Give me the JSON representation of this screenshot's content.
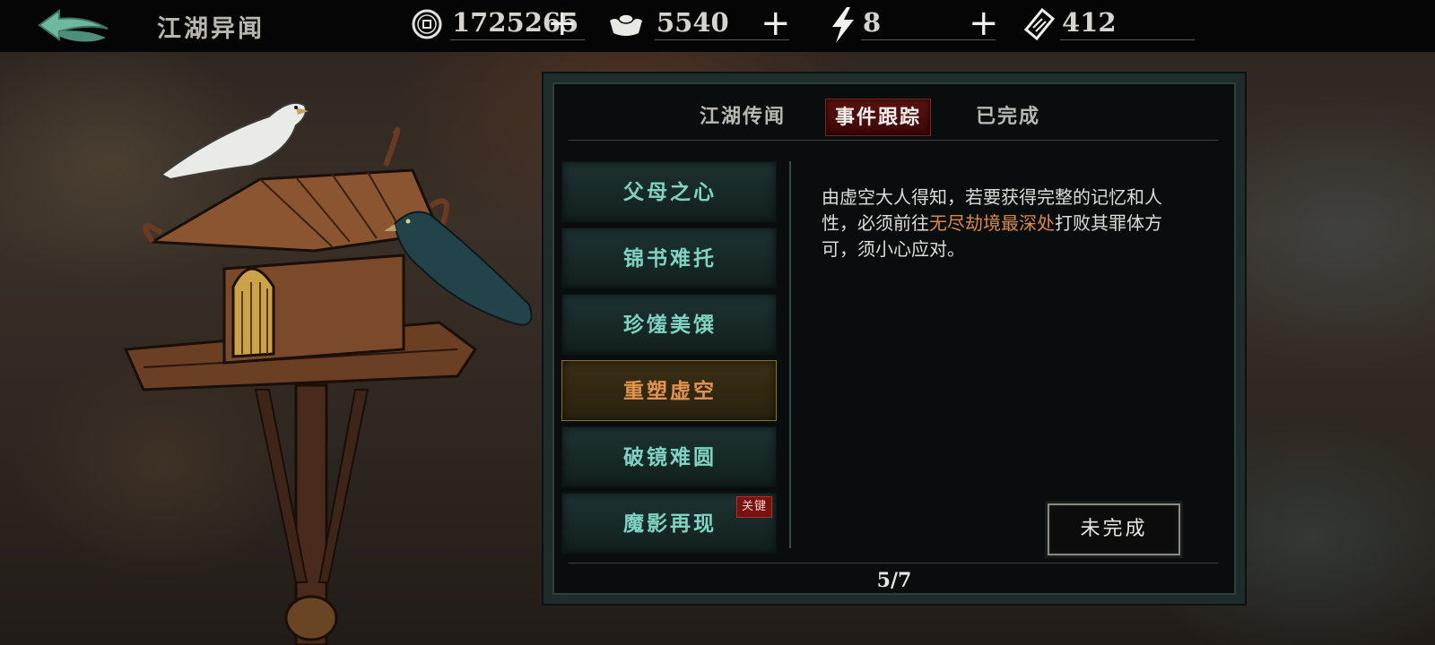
{
  "header": {
    "title": "江湖异闻",
    "back_icon": "back-arrow-icon",
    "resources": [
      {
        "id": "coins",
        "icon": "copper-coin-icon",
        "value": "1725265"
      },
      {
        "id": "ingots",
        "icon": "silver-ingot-icon",
        "value": "5540"
      },
      {
        "id": "energy",
        "icon": "lightning-icon",
        "value": "8"
      },
      {
        "id": "tickets",
        "icon": "ticket-icon",
        "value": "412"
      }
    ],
    "plus_label": "+"
  },
  "tabs": [
    {
      "label": "江湖传闻",
      "active": false
    },
    {
      "label": "事件跟踪",
      "active": true
    },
    {
      "label": "已完成",
      "active": false
    }
  ],
  "events": [
    {
      "label": "父母之心",
      "selected": false
    },
    {
      "label": "锦书难托",
      "selected": false
    },
    {
      "label": "珍馐美馔",
      "selected": false
    },
    {
      "label": "重塑虚空",
      "selected": true
    },
    {
      "label": "破镜难圆",
      "selected": false
    },
    {
      "label": "魔影再现",
      "selected": false,
      "badge": "关键"
    }
  ],
  "detail": {
    "text_before": "由虚空大人得知，若要获得完整的记忆和人性，必须前往",
    "highlight": "无尽劫境最深处",
    "text_after": "打败其罪体方可，须小心应对。",
    "status_button": "未完成"
  },
  "pagination": "5/7",
  "colors": {
    "accent_teal": "#7fd3c2",
    "selected_orange": "#e3934f",
    "highlight_orange": "#d98a4a",
    "active_tab_red": "#5a1212"
  }
}
